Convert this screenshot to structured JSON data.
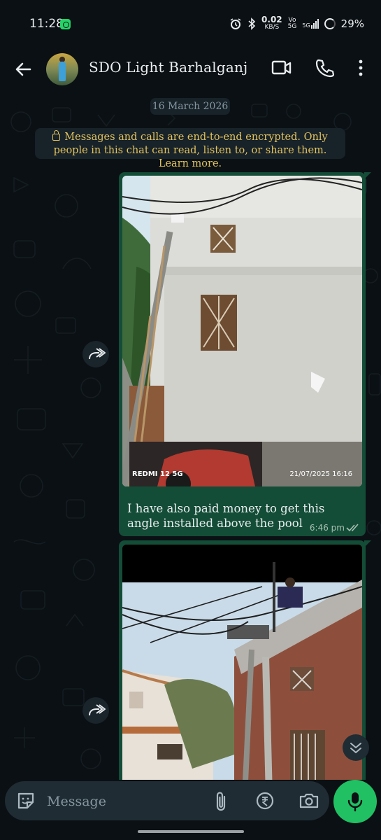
{
  "status_bar": {
    "time": "11:28",
    "speed_value": "0.02",
    "speed_unit": "KB/S",
    "volte_top": "Vo",
    "volte_bottom": "5G",
    "network": "5G",
    "battery": "29%"
  },
  "header": {
    "contact_name": "SDO Light Barhalganj"
  },
  "chat": {
    "date_chip": "16 March 2026",
    "encryption_notice": "Messages and calls are end-to-end encrypted. Only people in this chat can read, listen to, or share them. Learn more.",
    "messages": [
      {
        "type": "image",
        "photo_watermark_left": "REDMI 12 5G",
        "photo_watermark_right": "21/07/2025 16:16",
        "caption": "I have also paid money to get this angle installed above the pool",
        "time": "6:46 pm",
        "status": "read"
      },
      {
        "type": "image",
        "caption": "",
        "time": ""
      }
    ]
  },
  "composer": {
    "placeholder": "Message"
  },
  "colors": {
    "background": "#0b1014",
    "outgoing_bubble": "#144d37",
    "mic_button": "#21c063",
    "encryption_text": "#e3c45e"
  },
  "icons": [
    "back-arrow-icon",
    "video-call-icon",
    "phone-icon",
    "more-options-icon",
    "lock-icon",
    "forward-icon",
    "double-tick-icon",
    "scroll-down-icon",
    "sticker-icon",
    "attach-icon",
    "rupee-icon",
    "camera-icon",
    "mic-icon"
  ]
}
